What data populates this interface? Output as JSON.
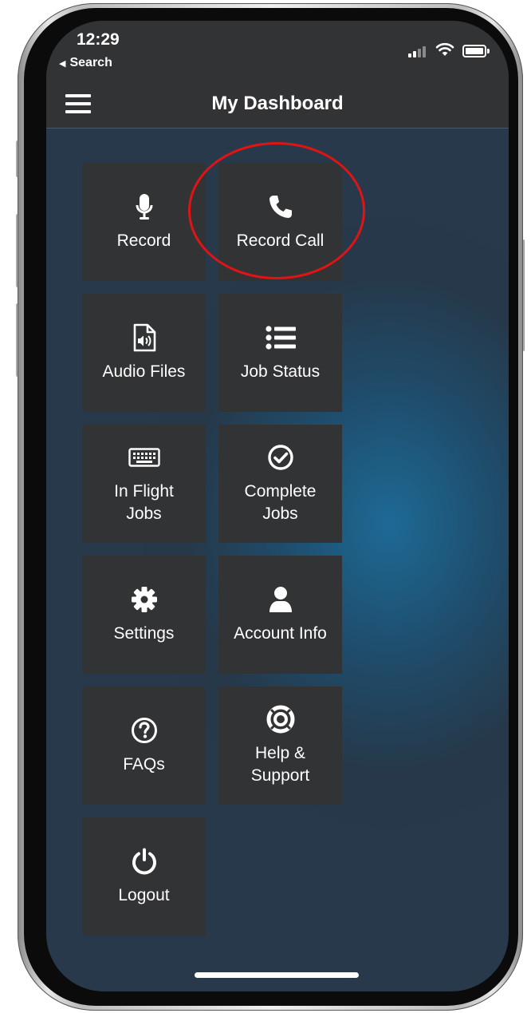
{
  "status_bar": {
    "time": "12:29",
    "back_label": "Search"
  },
  "header": {
    "title": "My Dashboard"
  },
  "tiles": [
    {
      "label": "Record",
      "icon": "microphone-icon"
    },
    {
      "label": "Record Call",
      "icon": "phone-icon"
    },
    {
      "label": "Audio Files",
      "icon": "audio-file-icon"
    },
    {
      "label": "Job Status",
      "icon": "list-icon"
    },
    {
      "label": "In Flight\nJobs",
      "icon": "keyboard-icon"
    },
    {
      "label": "Complete\nJobs",
      "icon": "check-circle-icon"
    },
    {
      "label": "Settings",
      "icon": "gear-icon"
    },
    {
      "label": "Account Info",
      "icon": "user-icon"
    },
    {
      "label": "FAQs",
      "icon": "question-circle-icon"
    },
    {
      "label": "Help &\nSupport",
      "icon": "life-ring-icon"
    },
    {
      "label": "Logout",
      "icon": "power-icon"
    }
  ],
  "annotation": {
    "highlight_color": "#e01414",
    "highlighted_tile": "Record Call"
  },
  "colors": {
    "tile_bg": "#323335",
    "header_bg": "#323335",
    "accent_glow": "#1d6a96"
  }
}
